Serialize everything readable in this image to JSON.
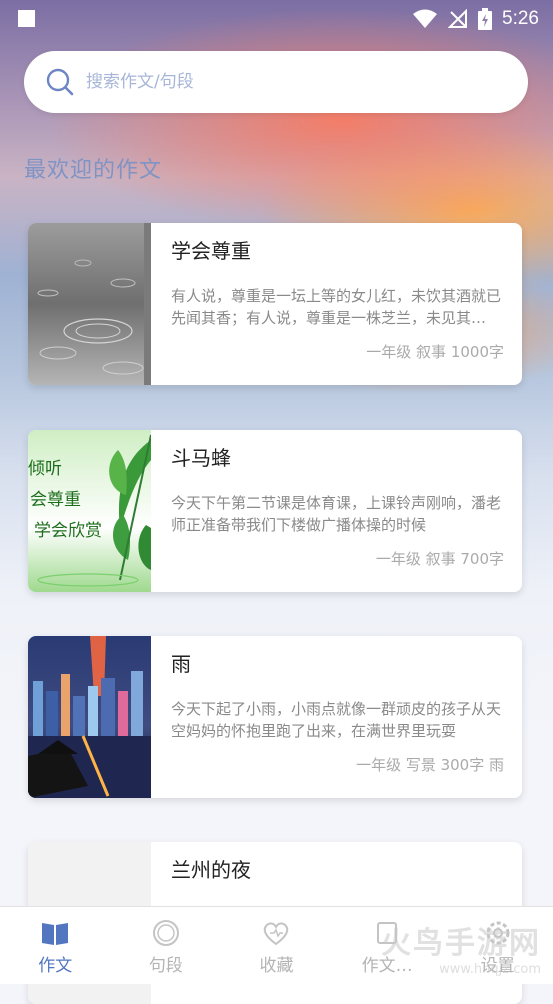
{
  "status_bar": {
    "time": "5:26"
  },
  "search": {
    "placeholder": "搜索作文/句段"
  },
  "section": {
    "title": "最欢迎的作文"
  },
  "cards": [
    {
      "title": "学会尊重",
      "desc": "有人说，尊重是一坛上等的女儿红，未饮其酒就已先闻其香；有人说，尊重是一株芝兰，未见其花就已先闻其香",
      "meta": "一年级 叙事 1000字",
      "thumb": "rain-drops-image"
    },
    {
      "title": "斗马蜂",
      "desc": "今天下午第二节课是体育课，上课铃声刚响，潘老师正准备带我们下楼做广播体操的时候",
      "meta": "一年级 叙事 700字",
      "thumb": "green-leaf-image",
      "thumb_text": [
        "倾听",
        "会尊重",
        "学会欣赏"
      ]
    },
    {
      "title": "雨",
      "desc": "今天下起了小雨，小雨点就像一群顽皮的孩子从天空妈妈的怀抱里跑了出来，在满世界里玩耍",
      "meta": "一年级 写景 300字 雨",
      "thumb": "city-night-image"
    },
    {
      "title": "兰州的夜",
      "desc": "",
      "meta": "",
      "thumb": "blank-image"
    }
  ],
  "nav": {
    "items": [
      {
        "label": "作文",
        "icon": "book-icon",
        "active": true
      },
      {
        "label": "句段",
        "icon": "circle-icon",
        "active": false
      },
      {
        "label": "收藏",
        "icon": "heart-icon",
        "active": false
      },
      {
        "label": "作文…",
        "icon": "unknown-icon",
        "active": false
      },
      {
        "label": "设置",
        "icon": "gear-icon",
        "active": false
      }
    ]
  },
  "watermark": {
    "main": "火鸟手游网",
    "sub": "www.hnqjz.com"
  },
  "colors": {
    "accent": "#5277c0",
    "title_blue": "#7f93c4",
    "placeholder": "#a7b5d8"
  }
}
